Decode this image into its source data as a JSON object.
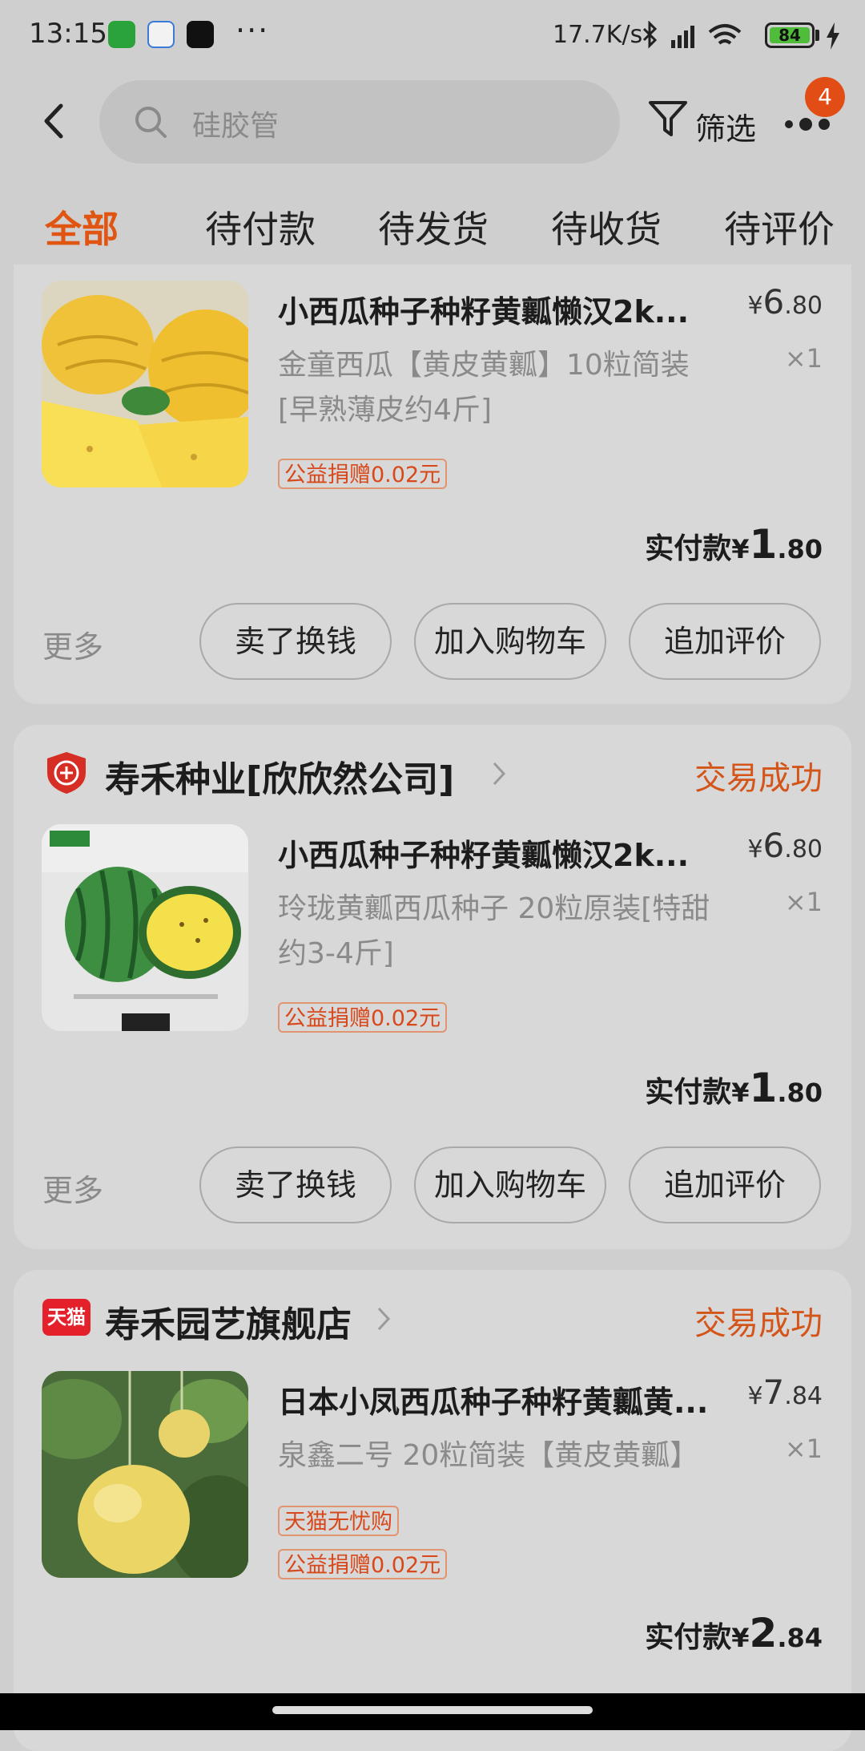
{
  "status_bar": {
    "time": "13:15",
    "more": "···",
    "net_speed": "17.7K/s",
    "battery": "84",
    "icons": [
      "bluetooth-icon",
      "hd-signal-icon",
      "wifi-icon",
      "battery-icon",
      "charging-icon"
    ]
  },
  "header": {
    "search_placeholder": "硅胶管",
    "filter_label": "筛选",
    "notification_count": "4"
  },
  "tabs": [
    "全部",
    "待付款",
    "待发货",
    "待收货",
    "待评价"
  ],
  "active_tab": "全部",
  "accent_color": "#e05512",
  "orders": [
    {
      "product_title": "小西瓜种子种籽黄瓤懒汉2k...",
      "price_symbol": "¥",
      "price_int": "6",
      "price_dec": ".80",
      "sku": "金童西瓜【黄皮黄瓤】10粒简装[早熟薄皮约4斤]",
      "qty": "×1",
      "tags": [
        "公益捐赠0.02元"
      ],
      "paid_label": "实付款",
      "paid_symbol": "¥",
      "paid_int": "1",
      "paid_dec": ".80",
      "more": "更多",
      "actions": [
        "卖了换钱",
        "加入购物车",
        "追加评价"
      ]
    },
    {
      "shop_name": "寿禾种业[欣欣然公司]",
      "shop_type": "enterprise",
      "status": "交易成功",
      "product_title": "小西瓜种子种籽黄瓤懒汉2k...",
      "price_symbol": "¥",
      "price_int": "6",
      "price_dec": ".80",
      "sku": "玲珑黄瓤西瓜种子 20粒原装[特甜约3-4斤]",
      "qty": "×1",
      "tags": [
        "公益捐赠0.02元"
      ],
      "paid_label": "实付款",
      "paid_symbol": "¥",
      "paid_int": "1",
      "paid_dec": ".80",
      "more": "更多",
      "actions": [
        "卖了换钱",
        "加入购物车",
        "追加评价"
      ]
    },
    {
      "shop_name": "寿禾园艺旗舰店",
      "shop_logo_text": "天猫",
      "status": "交易成功",
      "product_title": "日本小凤西瓜种子种籽黄瓤黄...",
      "price_symbol": "¥",
      "price_int": "7",
      "price_dec": ".84",
      "sku": "泉鑫二号 20粒简装【黄皮黄瓤】",
      "qty": "×1",
      "tags": [
        "天猫无忧购",
        "公益捐赠0.02元"
      ],
      "paid_label": "实付款",
      "paid_symbol": "¥",
      "paid_int": "2",
      "paid_dec": ".84"
    }
  ]
}
